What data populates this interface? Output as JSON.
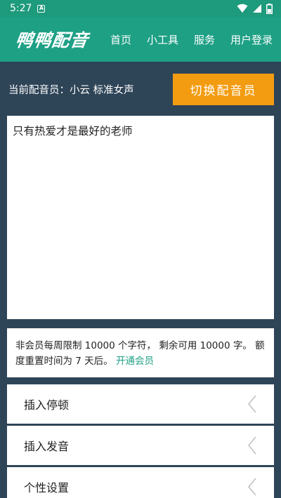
{
  "status_bar": {
    "time": "5:27",
    "notification_letter": "A"
  },
  "header": {
    "logo": "鸭鸭配音",
    "nav": [
      {
        "label": "首页"
      },
      {
        "label": "小工具"
      },
      {
        "label": "服务"
      },
      {
        "label": "用户登录"
      }
    ]
  },
  "voice": {
    "current_label": "当前配音员：小云 标准女声",
    "switch_button": "切换配音员"
  },
  "editor": {
    "text": "只有热爱才是最好的老师"
  },
  "quota": {
    "text": "非会员每周限制 10000 个字符， 剩余可用 10000 字。 额度重置时间为 7 天后。",
    "link": "开通会员"
  },
  "options": [
    {
      "label": "插入停顿"
    },
    {
      "label": "插入发音"
    },
    {
      "label": "个性设置"
    }
  ],
  "colors": {
    "header": "#1ea085",
    "background": "#2e4457",
    "accent": "#f39c12"
  }
}
